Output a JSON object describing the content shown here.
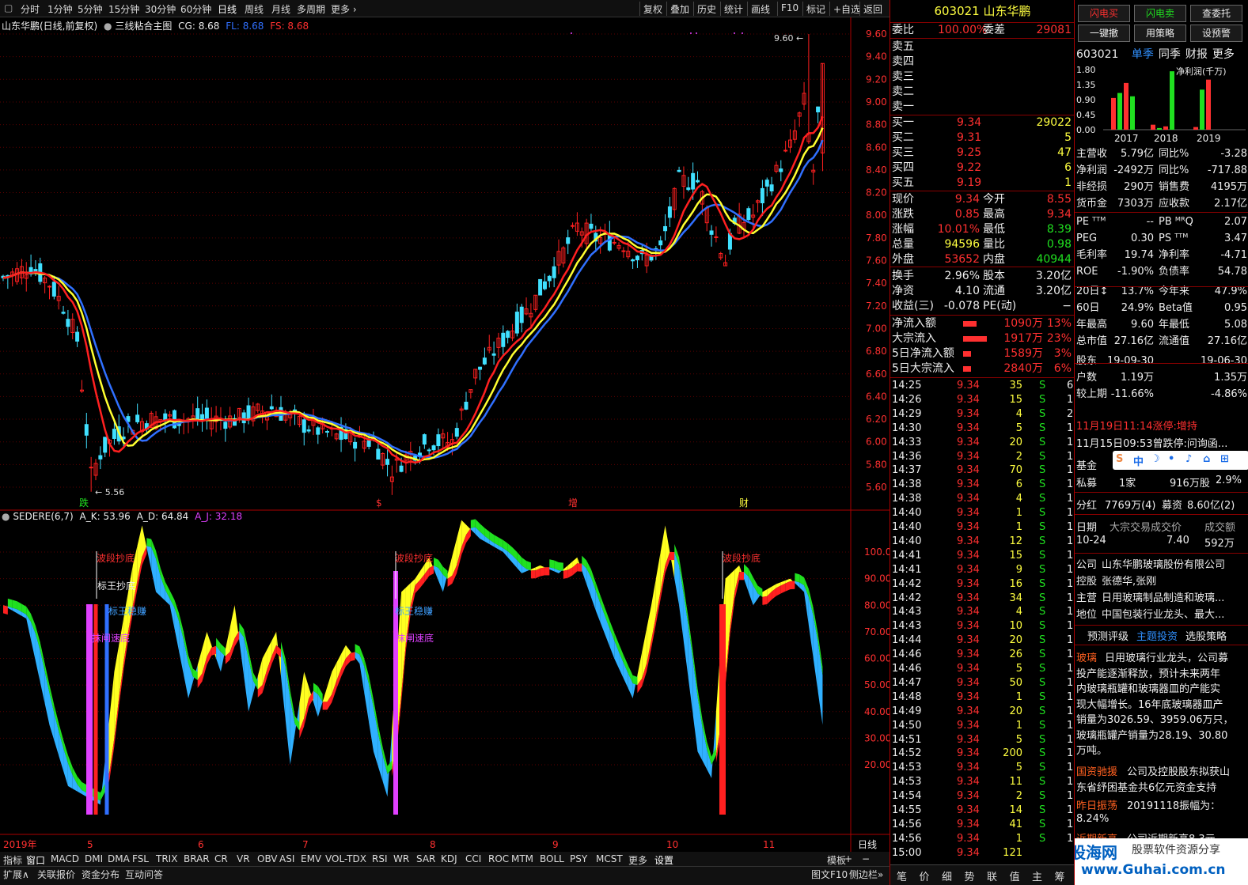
{
  "toolbar": {
    "left_items": [
      "分时",
      "1分钟",
      "5分钟",
      "15分钟",
      "30分钟",
      "60分钟",
      "日线",
      "周线",
      "月线",
      "多周期",
      "更多"
    ],
    "right_items": [
      "复权",
      "叠加",
      "历史",
      "统计",
      "画线",
      "F10",
      "标记",
      "+自选",
      "返回"
    ]
  },
  "main_chart": {
    "title": "山东华鹏(日线,前复权)",
    "indicator": "三线粘合主图",
    "cg": "CG: 8.68",
    "fl": "FL: 8.68",
    "fs": "FS: 8.68",
    "price_labels": [
      "9.60",
      "9.40",
      "9.20",
      "9.00",
      "8.80",
      "8.60",
      "8.40",
      "8.20",
      "8.00",
      "7.80",
      "7.60",
      "7.40",
      "7.20",
      "7.00",
      "6.80",
      "6.60",
      "6.40",
      "6.20",
      "6.00",
      "5.80",
      "5.60"
    ],
    "high_label": "9.60",
    "low_label": "5.56",
    "markers": [
      "跌",
      "$",
      "增",
      "财"
    ],
    "colors": {
      "mid": "#ff2020",
      "fast": "#ffff30",
      "slow": "#3070ff",
      "up": "#ff2020",
      "down": "#40e0ff"
    }
  },
  "sub_chart": {
    "title": "SEDERE(6,7)",
    "ak": "A_K: 53.96",
    "ad": "A_D: 64.84",
    "aj": "A_J: 32.18",
    "levels": [
      "100.0",
      "90.00",
      "80.00",
      "70.00",
      "60.00",
      "50.00",
      "40.00",
      "30.00",
      "20.00"
    ],
    "annotations": [
      "波段抄底",
      "标王抄底",
      "标王稳赚",
      "抹闸速底"
    ]
  },
  "x_axis": {
    "labels": [
      "2019年",
      "5",
      "6",
      "7",
      "8",
      "9",
      "10",
      "11"
    ],
    "period": "日线"
  },
  "bottom_tabs": [
    "指标",
    "窗口",
    "MACD",
    "DMI",
    "DMA",
    "FSL",
    "TRIX",
    "BRAR",
    "CR",
    "VR",
    "OBV",
    "ASI",
    "EMV",
    "VOL-TDX",
    "RSI",
    "WR",
    "SAR",
    "KDJ",
    "CCI",
    "ROC",
    "MTM",
    "BOLL",
    "PSY",
    "MCST",
    "更多",
    "设置"
  ],
  "bottom_right": [
    "模板",
    "+",
    "−"
  ],
  "sub_tabs": [
    "扩展∧",
    "关联报价",
    "资金分布",
    "互动问答"
  ],
  "sub_tabs_right": [
    "图文F10",
    "侧边栏»"
  ],
  "quote": {
    "code": "603021",
    "name": "山东华鹏",
    "weibi_label": "委比",
    "weibi": "100.00%",
    "weicha_label": "委差",
    "weicha": "29081",
    "sells": [
      "卖五",
      "卖四",
      "卖三",
      "卖二",
      "卖一"
    ],
    "buys": [
      {
        "label": "买一",
        "price": "9.34",
        "vol": "29022"
      },
      {
        "label": "买二",
        "price": "9.31",
        "vol": "5"
      },
      {
        "label": "买三",
        "price": "9.25",
        "vol": "47"
      },
      {
        "label": "买四",
        "price": "9.22",
        "vol": "6"
      },
      {
        "label": "买五",
        "price": "9.19",
        "vol": "1"
      }
    ],
    "stats": [
      {
        "l1": "现价",
        "v1": "9.34",
        "c1": "red",
        "l2": "今开",
        "v2": "8.55",
        "c2": "red"
      },
      {
        "l1": "涨跌",
        "v1": "0.85",
        "c1": "red",
        "l2": "最高",
        "v2": "9.34",
        "c2": "red"
      },
      {
        "l1": "涨幅",
        "v1": "10.01%",
        "c1": "red",
        "l2": "最低",
        "v2": "8.39",
        "c2": "green"
      },
      {
        "l1": "总量",
        "v1": "94596",
        "c1": "yellow",
        "l2": "量比",
        "v2": "0.98",
        "c2": "green"
      },
      {
        "l1": "外盘",
        "v1": "53652",
        "c1": "red",
        "l2": "内盘",
        "v2": "40944",
        "c2": "green"
      },
      {
        "l1": "换手",
        "v1": "2.96%",
        "c1": "white",
        "l2": "股本",
        "v2": "3.20亿",
        "c2": "white"
      },
      {
        "l1": "净资",
        "v1": "4.10",
        "c1": "white",
        "l2": "流通",
        "v2": "3.20亿",
        "c2": "white"
      },
      {
        "l1": "收益(三)",
        "v1": "-0.078",
        "c1": "white",
        "l2": "PE(动)",
        "v2": "−",
        "c2": "white"
      }
    ],
    "flows": [
      {
        "label": "净流入额",
        "value": "1090万",
        "pct": "13%",
        "bar": 0.13
      },
      {
        "label": "大宗流入",
        "value": "1917万",
        "pct": "23%",
        "bar": 0.23
      },
      {
        "label": "5日净流入额",
        "value": "1589万",
        "pct": "3%",
        "bar": 0.03
      },
      {
        "label": "5日大宗流入",
        "value": "2840万",
        "pct": "6%",
        "bar": 0.06
      }
    ],
    "ticks": [
      [
        "14:25",
        "9.34",
        "35",
        "S",
        "6"
      ],
      [
        "14:26",
        "9.34",
        "15",
        "S",
        "1"
      ],
      [
        "14:29",
        "9.34",
        "4",
        "S",
        "2"
      ],
      [
        "14:30",
        "9.34",
        "5",
        "S",
        "1"
      ],
      [
        "14:33",
        "9.34",
        "20",
        "S",
        "1"
      ],
      [
        "14:36",
        "9.34",
        "2",
        "S",
        "1"
      ],
      [
        "14:37",
        "9.34",
        "70",
        "S",
        "1"
      ],
      [
        "14:38",
        "9.34",
        "6",
        "S",
        "1"
      ],
      [
        "14:38",
        "9.34",
        "4",
        "S",
        "1"
      ],
      [
        "14:40",
        "9.34",
        "1",
        "S",
        "1"
      ],
      [
        "14:40",
        "9.34",
        "1",
        "S",
        "1"
      ],
      [
        "14:40",
        "9.34",
        "12",
        "S",
        "1"
      ],
      [
        "14:41",
        "9.34",
        "15",
        "S",
        "1"
      ],
      [
        "14:41",
        "9.34",
        "9",
        "S",
        "1"
      ],
      [
        "14:42",
        "9.34",
        "16",
        "S",
        "1"
      ],
      [
        "14:42",
        "9.34",
        "34",
        "S",
        "1"
      ],
      [
        "14:43",
        "9.34",
        "4",
        "S",
        "1"
      ],
      [
        "14:43",
        "9.34",
        "10",
        "S",
        "1"
      ],
      [
        "14:44",
        "9.34",
        "20",
        "S",
        "1"
      ],
      [
        "14:46",
        "9.34",
        "26",
        "S",
        "1"
      ],
      [
        "14:46",
        "9.34",
        "5",
        "S",
        "1"
      ],
      [
        "14:47",
        "9.34",
        "50",
        "S",
        "1"
      ],
      [
        "14:48",
        "9.34",
        "1",
        "S",
        "1"
      ],
      [
        "14:49",
        "9.34",
        "20",
        "S",
        "1"
      ],
      [
        "14:50",
        "9.34",
        "1",
        "S",
        "1"
      ],
      [
        "14:51",
        "9.34",
        "5",
        "S",
        "1"
      ],
      [
        "14:52",
        "9.34",
        "200",
        "S",
        "1"
      ],
      [
        "14:53",
        "9.34",
        "5",
        "S",
        "1"
      ],
      [
        "14:53",
        "9.34",
        "11",
        "S",
        "1"
      ],
      [
        "14:54",
        "9.34",
        "2",
        "S",
        "1"
      ],
      [
        "14:55",
        "9.34",
        "14",
        "S",
        "1"
      ],
      [
        "14:56",
        "9.34",
        "41",
        "S",
        "1"
      ],
      [
        "14:56",
        "9.34",
        "1",
        "S",
        "1"
      ],
      [
        "15:00",
        "9.34",
        "121",
        "",
        ""
      ]
    ],
    "bottom_tabs": [
      "笔",
      "价",
      "细",
      "势",
      "联",
      "值",
      "主",
      "筹"
    ]
  },
  "info": {
    "buttons": [
      "闪电买",
      "闪电卖",
      "查委托",
      "一键撤",
      "用策略",
      "设预警"
    ],
    "code": "603021",
    "tabs": [
      "单季",
      "同季",
      "财报",
      "更多"
    ],
    "chart_title": "净利润(千万)",
    "chart_years": [
      "2017",
      "2018",
      "2019"
    ],
    "chart_y": [
      "1.80",
      "1.35",
      "0.90",
      "0.45",
      "0.00"
    ],
    "chart_data": {
      "type": "bar",
      "title": "净利润(千万)",
      "categories": [
        "2017",
        "2018",
        "2019"
      ],
      "ylim": [
        0,
        1.8
      ],
      "bars": [
        {
          "year": "2017",
          "q": [
            0.95,
            1.1,
            1.4,
            1.0
          ]
        },
        {
          "year": "2018",
          "q": [
            0.15,
            0.05,
            0.1,
            1.75
          ]
        },
        {
          "year": "2019",
          "q": [
            0.08,
            1.2,
            1.5
          ]
        }
      ]
    },
    "fin": [
      {
        "l1": "主营收",
        "v1": "5.79亿",
        "l2": "同比%",
        "v2": "-3.28"
      },
      {
        "l1": "净利润",
        "v1": "-2492万",
        "l2": "同比%",
        "v2": "-717.88"
      },
      {
        "l1": "非经损",
        "v1": "290万",
        "l2": "销售费",
        "v2": "4195万"
      },
      {
        "l1": "货币金",
        "v1": "7303万",
        "l2": "应收款",
        "v2": "2.17亿"
      },
      {
        "l1": "PE ᵀᵀᴹ",
        "v1": "--",
        "l2": "PB ᴹᴿQ",
        "v2": "2.07"
      },
      {
        "l1": "PEG",
        "v1": "0.30",
        "l2": "PS ᵀᵀᴹ",
        "v2": "3.47"
      },
      {
        "l1": "毛利率",
        "v1": "19.74",
        "l2": "净利率",
        "v2": "-4.71"
      },
      {
        "l1": "ROE",
        "v1": "-1.90%",
        "l2": "负债率",
        "v2": "54.78"
      },
      {
        "l1": "20日↕",
        "v1": "13.7%",
        "l2": "今年来",
        "v2": "47.9%"
      },
      {
        "l1": "60日",
        "v1": "24.9%",
        "l2": "Beta值",
        "v2": "0.95"
      },
      {
        "l1": "年最高",
        "v1": "9.60",
        "l2": "年最低",
        "v2": "5.08"
      },
      {
        "l1": "总市值",
        "v1": "27.16亿",
        "l2": "流通值",
        "v2": "27.16亿"
      },
      {
        "l1": "股东",
        "v1": "19-09-30",
        "l2": "",
        "v2": "19-06-30"
      },
      {
        "l1": "户数",
        "v1": "1.19万",
        "l2": "",
        "v2": "1.35万"
      },
      {
        "l1": "较上期",
        "v1": "-11.66%",
        "l2": "",
        "v2": "-4.86%"
      }
    ],
    "news1": "11月19日11:14涨停:增持",
    "news2": "11月15日09:53曾跌停:问询函...",
    "fund_label": "基金",
    "private_label": "私募",
    "private_v1": "1家",
    "private_v2": "916万股",
    "private_v3": "2.9%",
    "div_label": "分红",
    "div_v": "7769万(4)",
    "raise_label": "募资",
    "raise_v": "8.60亿(2)",
    "block_h1": "日期",
    "block_h2": "大宗交易成交价",
    "block_h3": "成交额",
    "block_d": "10-24",
    "block_p": "7.40",
    "block_a": "592万",
    "company_label": "公司",
    "company": "山东华鹏玻璃股份有限公司",
    "holder_label": "控股",
    "holder": "张德华,张刚",
    "main_label": "主营",
    "main": "日用玻璃制品制造和玻璃...",
    "pos_label": "地位",
    "pos": "中国包装行业龙头、最大...",
    "tabs2": [
      "预测评级",
      "主题投资",
      "选股策略"
    ],
    "theme1_tag": "玻璃",
    "theme1_lines": [
      "日用玻璃行业龙头，公司募",
      "投产能逐渐释放，预计未来两年",
      "内玻璃瓶罐和玻璃器皿的产能实",
      "现大幅增长。16年底玻璃器皿产",
      "销量为3026.59、3959.06万只，",
      "玻璃瓶罐产销量为28.19、30.80",
      "万吨。"
    ],
    "theme2_tag": "国资驰援",
    "theme2_lines": [
      "公司及控股股东拟获山",
      "东省纾困基金共6亿元资金支持"
    ],
    "theme3_tag": "昨日振荡",
    "theme3_lines": [
      "20191118振幅为：",
      "8.24%"
    ],
    "theme4_tag": "近期新高",
    "theme4_text": "公司近期新高8.3元"
  },
  "watermark": {
    "brand": "股海网",
    "slogan": "股票软件资源分享",
    "url": "www.Guhai.com.cn"
  }
}
